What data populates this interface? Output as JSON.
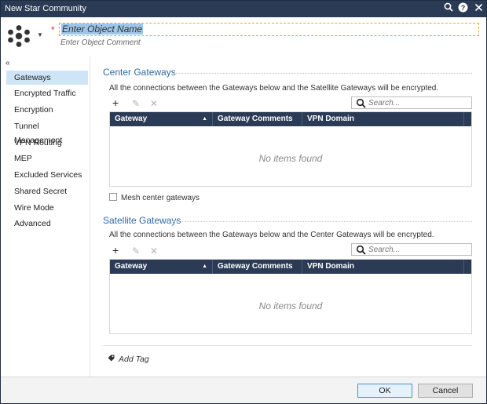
{
  "window": {
    "title": "New Star Community"
  },
  "titlebar": {
    "icons": [
      "search-icon",
      "help-icon",
      "close-icon"
    ]
  },
  "object": {
    "name_placeholder": "Enter Object Name",
    "comment_placeholder": "Enter Object Comment"
  },
  "sidebar": {
    "collapse_label": "«",
    "items": [
      {
        "label": "Gateways",
        "active": true
      },
      {
        "label": "Encrypted Traffic"
      },
      {
        "label": "Encryption"
      },
      {
        "label": "Tunnel Management"
      },
      {
        "label": "VPN Routing"
      },
      {
        "label": "MEP"
      },
      {
        "label": "Excluded Services"
      },
      {
        "label": "Shared Secret"
      },
      {
        "label": "Wire Mode"
      },
      {
        "label": "Advanced"
      }
    ]
  },
  "center": {
    "title": "Center Gateways",
    "description": "All the connections between the Gateways below and the Satellite Gateways will be encrypted.",
    "search_placeholder": "Search...",
    "columns": [
      "Gateway",
      "Gateway Comments",
      "VPN Domain"
    ],
    "empty_text": "No items found",
    "mesh_label": "Mesh center gateways"
  },
  "satellite": {
    "title": "Satellite Gateways",
    "description": "All the connections between the Gateways below and the Center Gateways will be encrypted.",
    "search_placeholder": "Search...",
    "columns": [
      "Gateway",
      "Gateway Comments",
      "VPN Domain"
    ],
    "empty_text": "No items found"
  },
  "tag": {
    "label": "Add Tag"
  },
  "footer": {
    "ok_label": "OK",
    "cancel_label": "Cancel"
  },
  "colors": {
    "accent": "#2d6aa4",
    "header_bg": "#2b3b55",
    "selection": "#cfe4f7"
  }
}
